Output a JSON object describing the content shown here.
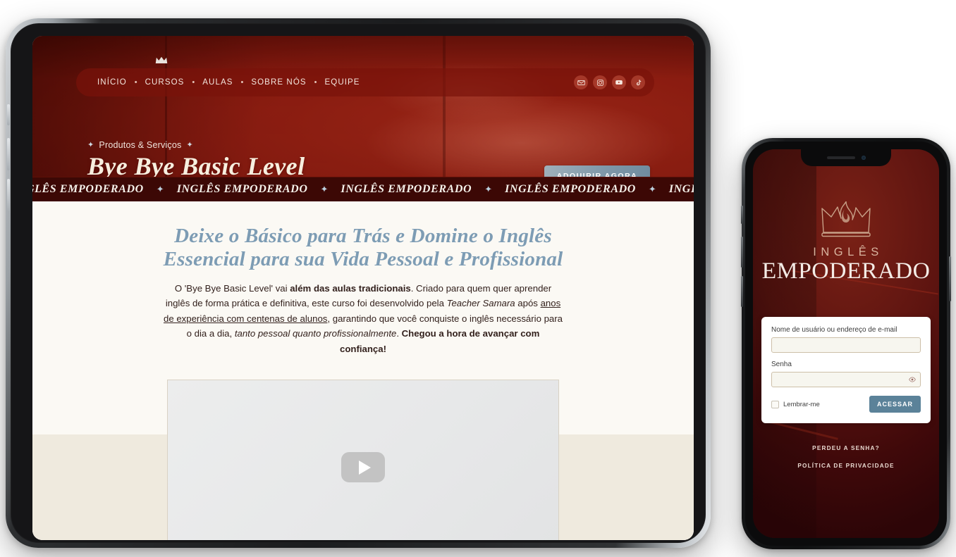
{
  "tablet": {
    "nav": {
      "crown_icon": "crown-icon",
      "items": [
        "INÍCIO",
        "CURSOS",
        "AULAS",
        "SOBRE NÓS",
        "EQUIPE"
      ],
      "separator": "•",
      "social": [
        {
          "name": "email-icon",
          "label": "E-mail"
        },
        {
          "name": "instagram-icon",
          "label": "Instagram"
        },
        {
          "name": "youtube-icon",
          "label": "YouTube"
        },
        {
          "name": "tiktok-icon",
          "label": "TikTok"
        }
      ]
    },
    "hero": {
      "eyebrow": "Produtos & Serviços",
      "ornament": "✦",
      "title": "Bye Bye Basic Level",
      "cta_label": "ADQUIRIR AGORA"
    },
    "marquee": {
      "text": "INGLÊS EMPODERADO",
      "separator": "✦",
      "repeat": 7
    },
    "main": {
      "heading_line1": "Deixe o Básico para Trás e Domine o Inglês",
      "heading_line2": "Essencial para sua Vida Pessoal e Profissional",
      "paragraph": {
        "p1": "O 'Bye Bye Basic Level' vai ",
        "b1": "além das aulas tradicionais",
        "p2": ". Criado para quem quer aprender inglês de forma prática e definitiva, este curso foi desenvolvido pela ",
        "i1": "Teacher Samara",
        "p3": " após ",
        "u1": "anos de experiência com centenas de alunos",
        "p4": ", garantindo que você conquiste o inglês necessário para o dia a dia, ",
        "i2": "tanto pessoal quanto profissionalmente",
        "p5": ". ",
        "b2": "Chegou a hora de avançar com confiança!"
      },
      "video_play_icon": "play-button-icon"
    }
  },
  "phone": {
    "brand": {
      "logo_icon": "crown-flame-logo-icon",
      "line1": "INGLÊS",
      "line2": "EMPODERADO"
    },
    "login": {
      "username_label": "Nome de usuário ou endereço de e-mail",
      "username_value": "",
      "password_label": "Senha",
      "password_value": "",
      "show_password_icon": "eye-icon",
      "remember_label": "Lembrar-me",
      "remember_checked": false,
      "submit_label": "ACESSAR"
    },
    "links": [
      "PERDEU A SENHA?",
      "POLÍTICA DE PRIVACIDADE"
    ]
  },
  "colors": {
    "hero_red": "#9a2214",
    "marquee_dark": "#3c0805",
    "heading_blue": "#7d9cb4",
    "cta_blue": "#7f98a9",
    "accessar_blue": "#5b8299",
    "cream": "#fbf9f4",
    "band_beige": "#efeade"
  }
}
